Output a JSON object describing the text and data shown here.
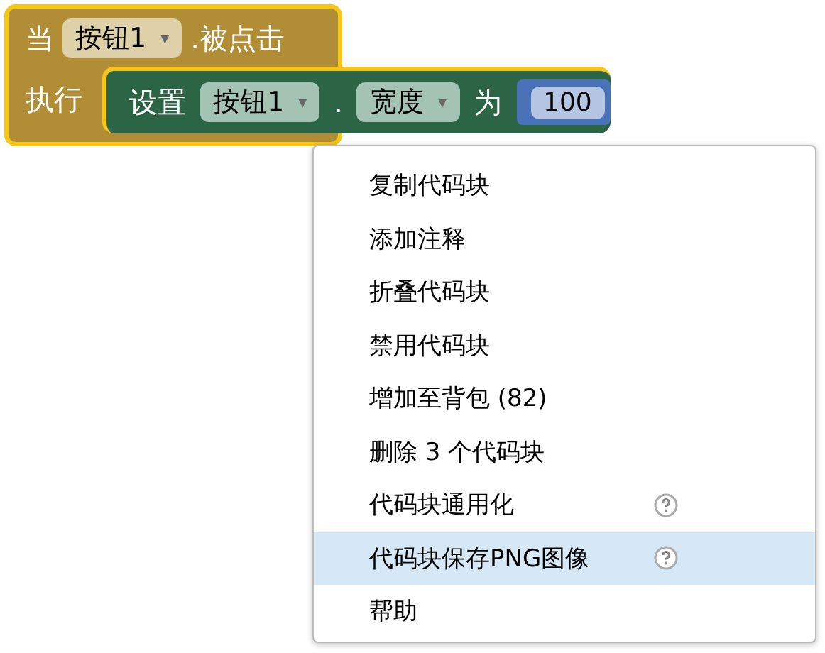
{
  "event_block": {
    "prefix": "当",
    "component": {
      "value": "按钮1",
      "caret": "▾"
    },
    "suffix": ".被点击",
    "do_label": "执行",
    "selected": true,
    "statement": {
      "prefix": "设置",
      "component": {
        "value": "按钮1",
        "caret": "▾"
      },
      "dot": ".",
      "property": {
        "value": "宽度",
        "caret": "▾"
      },
      "to_label": "为",
      "number": "100"
    }
  },
  "context_menu": {
    "items": [
      {
        "label": "复制代码块",
        "selected": false,
        "help_icon": false
      },
      {
        "label": "添加注释",
        "selected": false,
        "help_icon": false
      },
      {
        "label": "折叠代码块",
        "selected": false,
        "help_icon": false
      },
      {
        "label": "禁用代码块",
        "selected": false,
        "help_icon": false
      },
      {
        "label": "增加至背包 (82)",
        "selected": false,
        "help_icon": false
      },
      {
        "label": "删除 3 个代码块",
        "selected": false,
        "help_icon": false
      },
      {
        "label": "代码块通用化",
        "selected": false,
        "help_icon": true
      },
      {
        "label": "代码块保存PNG图像",
        "selected": true,
        "help_icon": true
      },
      {
        "label": "帮助",
        "selected": false,
        "help_icon": false
      }
    ]
  }
}
